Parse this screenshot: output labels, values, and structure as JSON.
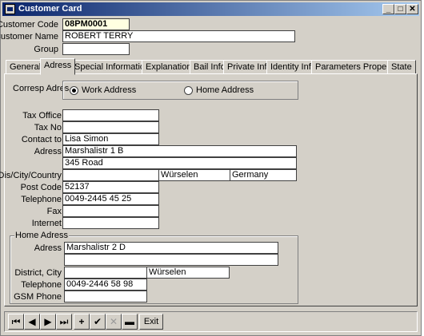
{
  "window": {
    "title": "Customer Card",
    "controls": {
      "minimize": "_",
      "maximize": "□",
      "close": "✕"
    }
  },
  "header": {
    "customer_code_label": "Customer Code",
    "customer_code": "08PM0001",
    "customer_name_label": "Customer Name",
    "customer_name": "ROBERT TERRY",
    "group_label": "Group",
    "group": ""
  },
  "tabs": [
    "General",
    "Adress",
    "Special Informations",
    "Explanations",
    "Bail Info",
    "Private Info",
    "Identity Info",
    "Parameters Properties",
    "State"
  ],
  "active_tab": "Adress",
  "adress": {
    "corresp_label": "Corresp Adres",
    "work_option": "Work Address",
    "home_option": "Home Address",
    "selected": "Work Address",
    "tax_office_label": "Tax Office",
    "tax_office": "",
    "tax_no_label": "Tax No",
    "tax_no": "",
    "contact_label": "Contact to",
    "contact": "Lisa Simon",
    "adress_label": "Adress",
    "adress_line1": "Marshalistr 1 B",
    "adress_line2": "345 Road",
    "dis_label": "Dis/City/Country",
    "district": "",
    "city": "Würselen",
    "country": "Germany",
    "post_code_label": "Post Code",
    "post_code": "52137",
    "telephone_label": "Telephone",
    "telephone": "0049-2445 45 25",
    "fax_label": "Fax",
    "fax": "",
    "internet_label": "Internet",
    "internet": ""
  },
  "home": {
    "group_title": "Home Adress",
    "adress_label": "Adress",
    "adress_line1": "Marshalistr 2 D",
    "adress_line2": "",
    "district_label": "District, City",
    "district": "",
    "city": "Würselen",
    "telephone_label": "Telephone",
    "telephone": "0049-2446 58 98",
    "gsm_label": "GSM Phone",
    "gsm": ""
  },
  "toolbar": {
    "first": "⏮",
    "prev": "◀",
    "next": "▶",
    "last": "⏭",
    "add": "+",
    "post": "✔",
    "cancel": "✕",
    "delete": "▬",
    "exit": "Exit"
  }
}
